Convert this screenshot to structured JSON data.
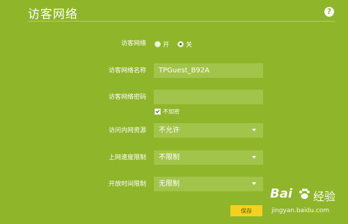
{
  "header": {
    "title": "访客网络",
    "help_icon": "?"
  },
  "form": {
    "guest_network": {
      "label": "访客网络",
      "options": [
        {
          "label": "开",
          "checked": false
        },
        {
          "label": "关",
          "checked": true
        }
      ]
    },
    "ssid": {
      "label": "访客网络名称",
      "value": "TPGuest_B92A"
    },
    "password": {
      "label": "访客网络密码",
      "value": "",
      "no_encrypt_label": "不加密",
      "no_encrypt_checked": true
    },
    "lan_access": {
      "label": "访问内网资源",
      "value": "不允许"
    },
    "speed_limit": {
      "label": "上网速度限制",
      "value": "不限制"
    },
    "time_limit": {
      "label": "开放时间限制",
      "value": "无限制"
    },
    "save_label": "保存"
  },
  "watermark": {
    "brand_left": "Bai",
    "brand_right": "经验",
    "url": "jingyan.baidu.com"
  },
  "colors": {
    "background": "#8fb52a",
    "field": "#a3c44a",
    "button": "#f2d21e"
  }
}
